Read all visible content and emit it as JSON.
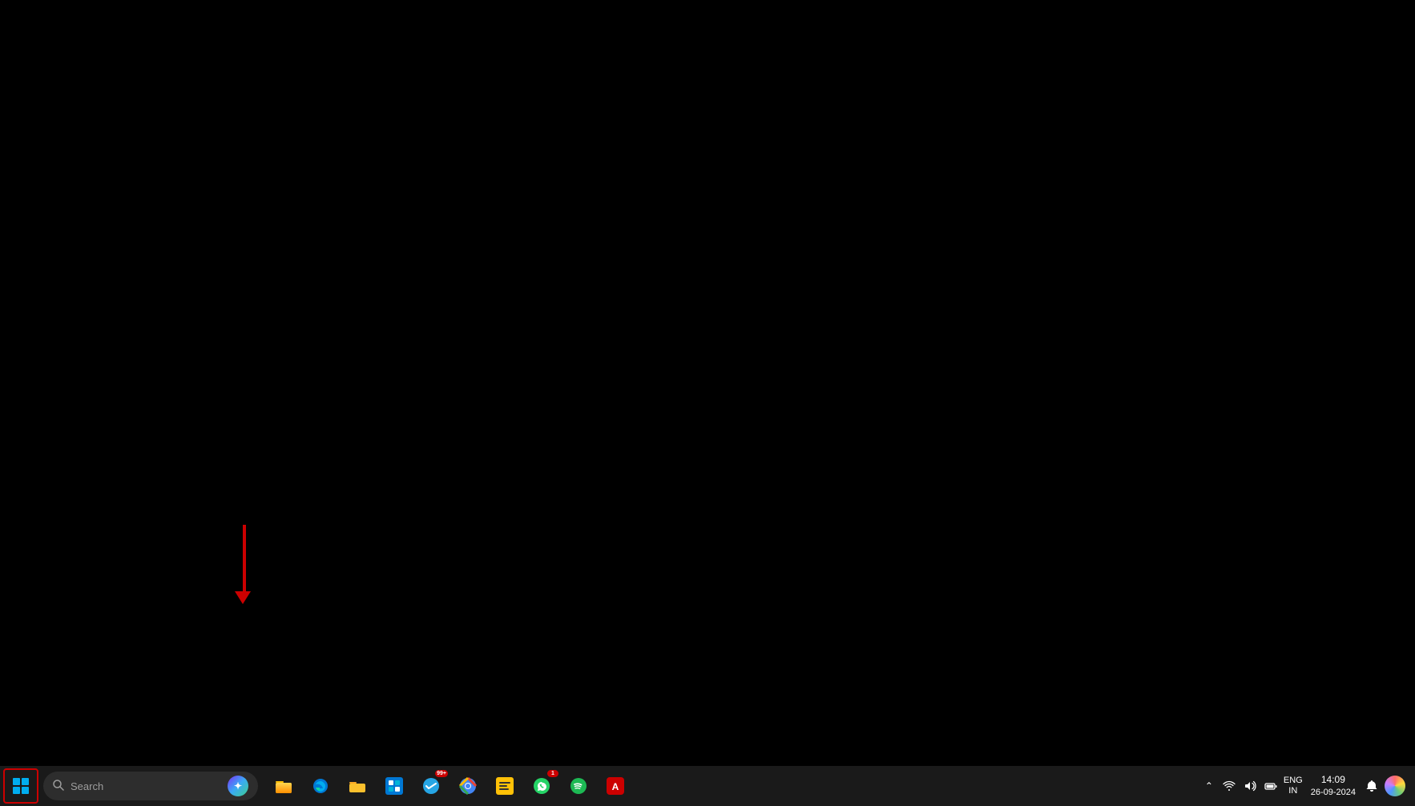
{
  "desktop": {
    "background_color": "#000000"
  },
  "arrow_annotation": {
    "visible": true,
    "color": "#cc0000"
  },
  "taskbar": {
    "background": "#1a1a1a",
    "start_button": {
      "label": "Start",
      "highlighted": true,
      "highlight_color": "#cc0000"
    },
    "search": {
      "placeholder": "Search",
      "logo_text": "🔍"
    },
    "apps": [
      {
        "name": "File Explorer",
        "icon": "📁",
        "id": "file-explorer"
      },
      {
        "name": "Microsoft Edge",
        "icon": "🌐",
        "id": "edge"
      },
      {
        "name": "Folder",
        "icon": "📂",
        "id": "folder-yellow"
      },
      {
        "name": "Microsoft Store",
        "icon": "🛍",
        "id": "ms-store"
      },
      {
        "name": "App1",
        "icon": "🅰",
        "id": "app1",
        "has_badge": true,
        "badge_count": "99+"
      },
      {
        "name": "Google Chrome",
        "icon": "🌐",
        "id": "chrome"
      },
      {
        "name": "Notes",
        "icon": "📝",
        "id": "notes"
      },
      {
        "name": "App2",
        "icon": "📷",
        "id": "app2",
        "has_badge": true,
        "badge_count": "1"
      },
      {
        "name": "Taskbar App",
        "icon": "💼",
        "id": "app3"
      }
    ],
    "system_tray": {
      "overflow_visible": true,
      "lang": "ENG",
      "region": "IN",
      "time": "14:09",
      "date": "26-09-2024",
      "wifi_icon": "📶",
      "volume_icon": "🔊",
      "battery_icon": "🔋",
      "notification_icon": "🔔",
      "color_wheel": true
    }
  }
}
